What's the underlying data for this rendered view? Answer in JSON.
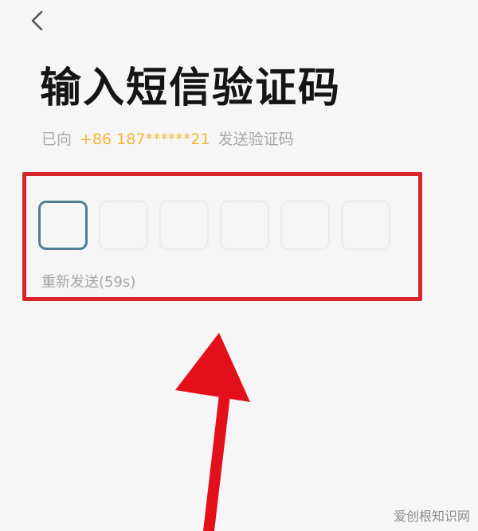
{
  "header": {
    "back_icon": "chevron-left-icon"
  },
  "page": {
    "title": "输入短信验证码",
    "sent_prefix": "已向",
    "phone": "+86 187******21",
    "sent_suffix": "发送验证码"
  },
  "code_input": {
    "length": 6,
    "resend_label": "重新发送(59s)"
  },
  "annotation": {
    "highlight_color": "#d9252c",
    "arrow_color": "#e3101b"
  },
  "watermark": {
    "text": "爱创根知识网"
  }
}
